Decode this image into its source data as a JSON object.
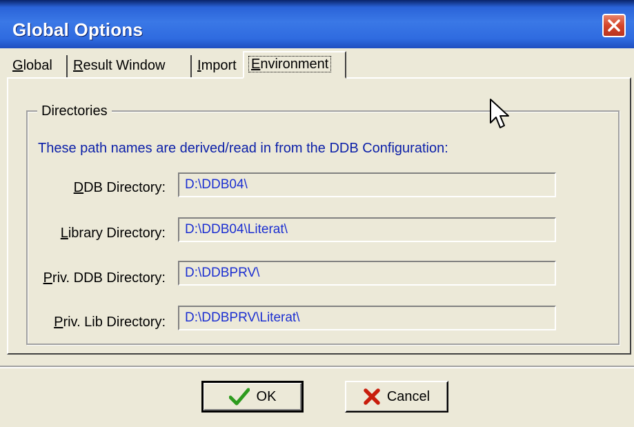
{
  "window": {
    "title": "Global Options"
  },
  "tabs": [
    {
      "label": "Global",
      "underline": "G",
      "rest": "lobal",
      "active": false
    },
    {
      "label": "Result Window",
      "underline": "R",
      "rest": "esult Window",
      "active": false
    },
    {
      "label": "Import",
      "underline": "I",
      "rest": "mport",
      "active": false
    },
    {
      "label": "Environment",
      "underline": "E",
      "rest": "nvironment",
      "active": true
    }
  ],
  "directories": {
    "group_label": "Directories",
    "info_text": "These path names are derived/read in from the DDB Configuration:",
    "fields": [
      {
        "label_u": "D",
        "label_rest": "DB Directory:",
        "value": "D:\\DDB04\\"
      },
      {
        "label_u": "L",
        "label_rest": "ibrary Directory:",
        "value": "D:\\DDB04\\Literat\\"
      },
      {
        "label_u": "P",
        "label_rest": "riv. DDB Directory:",
        "value": "D:\\DDBPRV\\"
      },
      {
        "label_u": "P",
        "label_rest": "riv. Lib Directory:",
        "value": "D:\\DDBPRV\\Literat\\"
      }
    ]
  },
  "buttons": {
    "ok": "OK",
    "cancel": "Cancel"
  },
  "colors": {
    "title_bar": "#2f6be0",
    "info_text": "#0b1fa8",
    "field_text": "#1c2fd1",
    "ok_check": "#2d9b1e",
    "cancel_x": "#c81d0c"
  },
  "icons": {
    "close": "close-icon",
    "ok": "checkmark-icon",
    "cancel": "x-icon",
    "cursor": "mouse-pointer-icon"
  }
}
